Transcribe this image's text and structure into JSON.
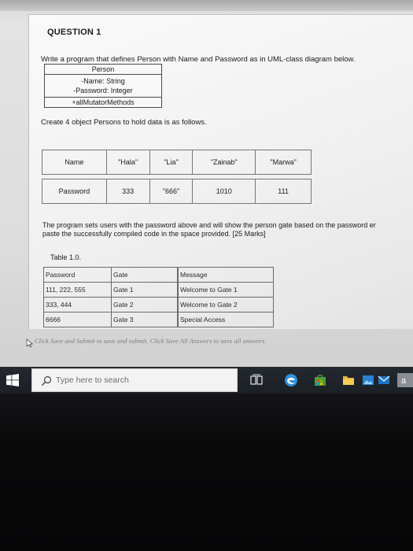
{
  "question": {
    "title": "QUESTION 1",
    "intro": "Write a program that defines Person with Name and Password as in UML-class diagram below.",
    "uml": {
      "class_name": "Person",
      "attributes": [
        "-Name: String",
        "-Password: Integer"
      ],
      "operations": "+allMutatorMethods"
    },
    "create_text": "Create 4 object Persons to hold data is as follows.",
    "persons_table": {
      "name_label": "Name",
      "password_label": "Password",
      "names": [
        "\"Hala\"",
        "\"Lia\"",
        "\"Zainab\"",
        "\"Marwa\""
      ],
      "passwords": [
        "333",
        "\"666\"",
        "1010",
        "111"
      ]
    },
    "paragraph_line1": "The program sets users with the password above and will show the person gate based on the password er",
    "paragraph_line2": "paste the successfully compiled code in the space provided. [25 Marks]",
    "table_caption": "Table 1.0.",
    "gate_table": {
      "headers": [
        "Password",
        "Gate",
        "Message"
      ],
      "rows": [
        [
          "111, 222, 555",
          "Gate 1",
          "Welcome to Gate 1"
        ],
        [
          "333, 444",
          "Gate 2",
          "Welcome to Gate 2"
        ],
        [
          "6666",
          "Gate 3",
          "Special Access"
        ]
      ]
    }
  },
  "footer": {
    "instruction": "Click Save and Submit to save and submit. Click Save All Answers to save all answers."
  },
  "taskbar": {
    "search_placeholder": "Type here to search",
    "icons": [
      "windows-start-icon",
      "search-icon",
      "task-view-icon",
      "edge-icon",
      "store-icon",
      "file-explorer-icon",
      "photos-icon",
      "mail-icon",
      "app-icon"
    ]
  },
  "colors": {
    "taskbar": "#1f252a",
    "edge_blue": "#2f8fd8",
    "store_green": "#4e9a3d",
    "explorer_yellow": "#e8b53a",
    "mail_blue": "#1f74c6"
  }
}
